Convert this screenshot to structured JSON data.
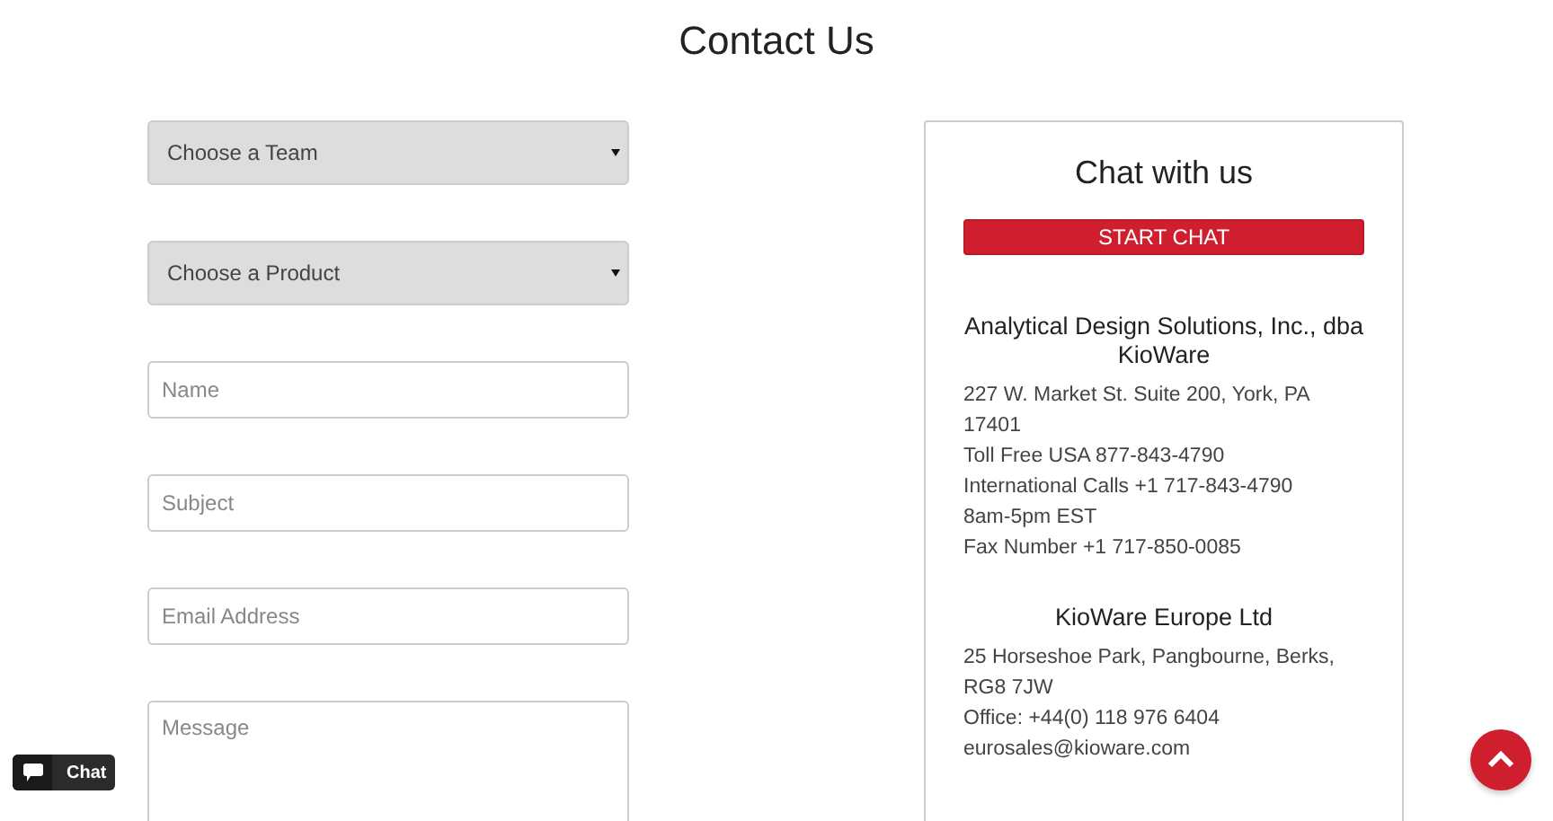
{
  "page_title": "Contact Us",
  "form": {
    "selects": [
      {
        "label": "Choose a Team"
      },
      {
        "label": "Choose a Product"
      }
    ],
    "fields": [
      {
        "kind": "input",
        "placeholder": "Name"
      },
      {
        "kind": "input",
        "placeholder": "Subject"
      },
      {
        "kind": "input",
        "placeholder": "Email Address"
      },
      {
        "kind": "textarea",
        "placeholder": "Message"
      }
    ]
  },
  "chat_card": {
    "title": "Chat with us",
    "button": "START CHAT",
    "offices": [
      {
        "name": "Analytical Design Solutions, Inc., dba KioWare",
        "lines": [
          "227 W. Market St. Suite 200, York, PA 17401",
          "Toll Free USA 877-843-4790",
          "International Calls +1 717-843-4790",
          "8am-5pm EST",
          "Fax Number +1 717-850-0085"
        ]
      },
      {
        "name": "KioWare Europe Ltd",
        "lines": [
          "25 Horseshoe Park, Pangbourne, Berks, RG8 7JW",
          "Office: +44(0) 118 976 6404",
          "eurosales@kioware.com"
        ]
      }
    ]
  },
  "chat_widget": {
    "label": "Chat"
  }
}
